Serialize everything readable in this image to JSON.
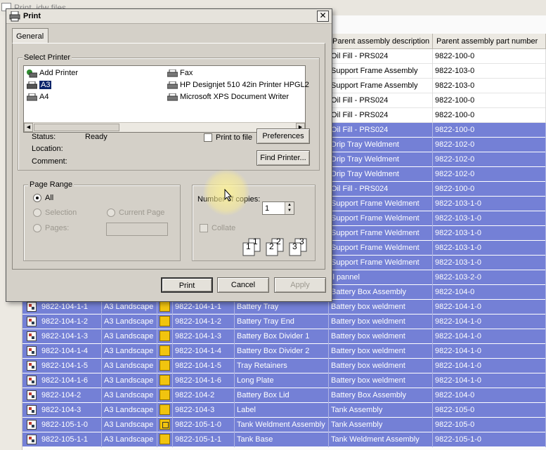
{
  "background_window": {
    "title": "Print .idw files"
  },
  "grid": {
    "columns": [
      "Parent assembly description",
      "Parent assembly part number"
    ],
    "rows": [
      {
        "parent_desc": "Oil Fill - PRS024",
        "parent_pn": "9822-100-0",
        "selected": false
      },
      {
        "parent_desc": "Support Frame Assembly",
        "parent_pn": "9822-103-0",
        "selected": false
      },
      {
        "parent_desc": "Support Frame Assembly",
        "parent_pn": "9822-103-0",
        "selected": false
      },
      {
        "parent_desc": "Oil Fill - PRS024",
        "parent_pn": "9822-100-0",
        "selected": false
      },
      {
        "parent_desc": "Oil Fill - PRS024",
        "parent_pn": "9822-100-0",
        "selected": false
      },
      {
        "parent_desc": "Oil Fill - PRS024",
        "parent_pn": "9822-100-0",
        "selected": true
      },
      {
        "parent_desc": "Drip Tray Weldment",
        "parent_pn": "9822-102-0",
        "selected": true
      },
      {
        "parent_desc": "Drip Tray Weldment",
        "parent_pn": "9822-102-0",
        "selected": true
      },
      {
        "parent_desc": "Drip Tray Weldment",
        "parent_pn": "9822-102-0",
        "selected": true
      },
      {
        "parent_desc": "Oil Fill - PRS024",
        "parent_pn": "9822-100-0",
        "selected": true
      },
      {
        "parent_desc": "Support Frame Weldment",
        "parent_pn": "9822-103-1-0",
        "selected": true
      },
      {
        "parent_desc": "Support Frame Weldment",
        "parent_pn": "9822-103-1-0",
        "selected": true
      },
      {
        "parent_desc": "Support Frame Weldment",
        "parent_pn": "9822-103-1-0",
        "selected": true
      },
      {
        "parent_desc": "Support Frame Weldment",
        "parent_pn": "9822-103-1-0",
        "selected": true
      },
      {
        "parent_desc": "Support Frame Weldment",
        "parent_pn": "9822-103-1-0",
        "selected": true
      },
      {
        "parent_desc": "il pannel",
        "parent_pn": "9822-103-2-0",
        "selected": true
      },
      {
        "parent_desc": "Battery Box Assembly",
        "parent_pn": "9822-104-0",
        "selected": true
      }
    ],
    "full_rows": [
      {
        "drawing": "9822-104-1-1",
        "sheet": "A3 Landscape",
        "part": "9822-104-1-1",
        "desc": "Battery Tray",
        "parent_desc": "Battery box weldment",
        "parent_pn": "9822-104-1-0",
        "asm": false
      },
      {
        "drawing": "9822-104-1-2",
        "sheet": "A3 Landscape",
        "part": "9822-104-1-2",
        "desc": "Battery Tray End",
        "parent_desc": "Battery box weldment",
        "parent_pn": "9822-104-1-0",
        "asm": false
      },
      {
        "drawing": "9822-104-1-3",
        "sheet": "A3 Landscape",
        "part": "9822-104-1-3",
        "desc": "Battery Box Divider 1",
        "parent_desc": "Battery box weldment",
        "parent_pn": "9822-104-1-0",
        "asm": false
      },
      {
        "drawing": "9822-104-1-4",
        "sheet": "A3 Landscape",
        "part": "9822-104-1-4",
        "desc": "Battery Box Divider 2",
        "parent_desc": "Battery box weldment",
        "parent_pn": "9822-104-1-0",
        "asm": false
      },
      {
        "drawing": "9822-104-1-5",
        "sheet": "A3 Landscape",
        "part": "9822-104-1-5",
        "desc": "Tray Retainers",
        "parent_desc": "Battery box weldment",
        "parent_pn": "9822-104-1-0",
        "asm": false
      },
      {
        "drawing": "9822-104-1-6",
        "sheet": "A3 Landscape",
        "part": "9822-104-1-6",
        "desc": "Long Plate",
        "parent_desc": "Battery box weldment",
        "parent_pn": "9822-104-1-0",
        "asm": false
      },
      {
        "drawing": "9822-104-2",
        "sheet": "A3 Landscape",
        "part": "9822-104-2",
        "desc": "Battery Box Lid",
        "parent_desc": "Battery Box Assembly",
        "parent_pn": "9822-104-0",
        "asm": false
      },
      {
        "drawing": "9822-104-3",
        "sheet": "A3 Landscape",
        "part": "9822-104-3",
        "desc": "Label",
        "parent_desc": "Tank Assembly",
        "parent_pn": "9822-105-0",
        "asm": false
      },
      {
        "drawing": "9822-105-1-0",
        "sheet": "A3 Landscape",
        "part": "9822-105-1-0",
        "desc": "Tank Weldment Assembly",
        "parent_desc": "Tank Assembly",
        "parent_pn": "9822-105-0",
        "asm": true
      },
      {
        "drawing": "9822-105-1-1",
        "sheet": "A3 Landscape",
        "part": "9822-105-1-1",
        "desc": "Tank Base",
        "parent_desc": "Tank Weldment Assembly",
        "parent_pn": "9822-105-1-0",
        "asm": false
      }
    ]
  },
  "dialog": {
    "title": "Print",
    "close_label": "✕",
    "tab": "General",
    "select_printer_label": "Select Printer",
    "printers_left": [
      {
        "name": "Add Printer",
        "selected": false
      },
      {
        "name": "A3",
        "selected": true
      },
      {
        "name": "A4",
        "selected": false
      }
    ],
    "printers_right": [
      {
        "name": "Fax"
      },
      {
        "name": "HP Designjet 510 42in Printer HPGL2"
      },
      {
        "name": "Microsoft XPS Document Writer"
      }
    ],
    "status_label": "Status:",
    "status_value": "Ready",
    "location_label": "Location:",
    "comment_label": "Comment:",
    "print_to_file_label": "Print to file",
    "preferences_label": "Preferences",
    "find_printer_label": "Find Printer...",
    "page_range_label": "Page Range",
    "all_label": "All",
    "selection_label": "Selection",
    "current_page_label": "Current Page",
    "pages_label": "Pages:",
    "copies_label": "Number of copies:",
    "copies_value": "1",
    "collate_label": "Collate",
    "collate_pages": [
      "1",
      "1",
      "2",
      "2",
      "3",
      "3"
    ],
    "print_label": "Print",
    "cancel_label": "Cancel",
    "apply_label": "Apply"
  },
  "colors": {
    "selection": "#7480d6",
    "selected_printer": "#0a246a"
  }
}
